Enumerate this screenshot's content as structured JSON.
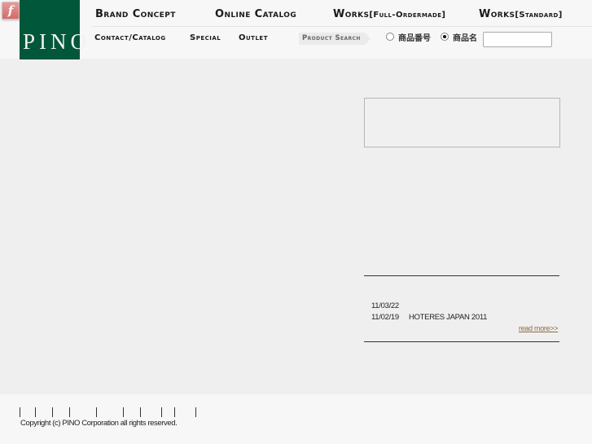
{
  "plugin": {
    "icon": "flash-plugin-icon",
    "glyph": "f"
  },
  "logo": {
    "text": "PINO"
  },
  "nav_main": [
    {
      "label": "Brand Concept",
      "sub": ""
    },
    {
      "label": "Online Catalog",
      "sub": ""
    },
    {
      "label": "Works",
      "sub": "[Full-Ordermade]"
    },
    {
      "label": "Works",
      "sub": "[Standard]"
    }
  ],
  "nav_sub": [
    {
      "label": "Contact/Catalog"
    },
    {
      "label": "Special"
    },
    {
      "label": "Outlet"
    }
  ],
  "search": {
    "label": "Product Search",
    "options": [
      {
        "label": "商品番号",
        "checked": false
      },
      {
        "label": "商品名",
        "checked": true
      }
    ],
    "value": "",
    "placeholder": ""
  },
  "news": {
    "items": [
      {
        "date": "11/03/22",
        "title": ""
      },
      {
        "date": "11/02/19",
        "title": "HOTERES JAPAN 2011"
      }
    ],
    "read_more": "read more>>"
  },
  "footer": {
    "link_separators": 10,
    "copyright": "Copyright (c) PINO Corporation all rights reserved."
  },
  "colors": {
    "logo_bg": "#01573a",
    "header_bg": "#f7f7f7",
    "body_bg": "#efefef",
    "link": "#8b6a45"
  }
}
